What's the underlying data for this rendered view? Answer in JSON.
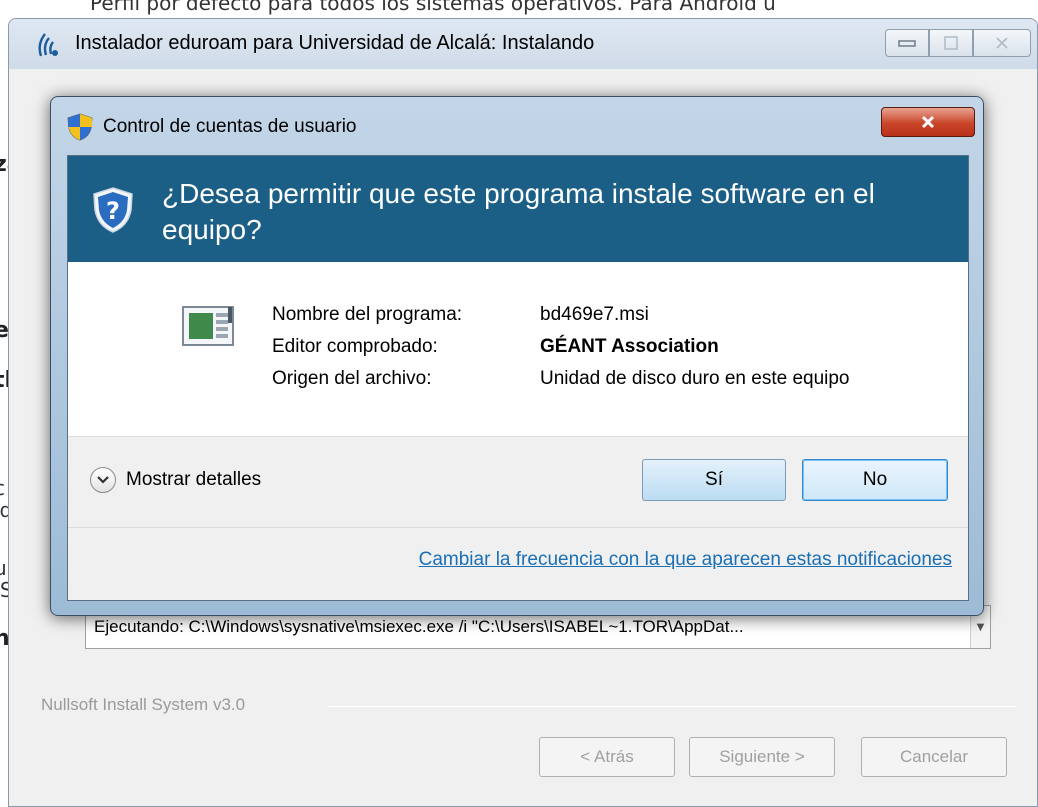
{
  "background": {
    "top_text": "Perfil por defecto para todos los sistemas operativos. Para Android u",
    "fragments": [
      "za",
      "e",
      "tl",
      "c",
      "'d",
      "u",
      "IS",
      "n"
    ]
  },
  "installer": {
    "title": "Instalador eduroam para Universidad de Alcalá: Instalando",
    "exec_text": "Ejecutando: C:\\Windows\\sysnative\\msiexec.exe /i \"C:\\Users\\ISABEL~1.TOR\\AppDat...",
    "nsis_label": "Nullsoft Install System v3.0",
    "buttons": {
      "back": "< Atrás",
      "next": "Siguiente >",
      "cancel": "Cancelar"
    }
  },
  "uac": {
    "title": "Control de cuentas de usuario",
    "question": "¿Desea permitir que este programa instale software en el equipo?",
    "fields": [
      {
        "label": "Nombre del programa:",
        "value": "bd469e7.msi"
      },
      {
        "label": "Editor comprobado:",
        "value": "GÉANT Association"
      },
      {
        "label": "Origen del archivo:",
        "value": "Unidad de disco duro en este equipo"
      }
    ],
    "details_label": "Mostrar detalles",
    "yes_label": "Sí",
    "no_label": "No",
    "frequency_link": "Cambiar la frecuencia con la que aparecen estas notificaciones"
  },
  "colors": {
    "uac_header": "#1b5e86",
    "link": "#1a6fb5",
    "close_button": "#c9452a"
  }
}
